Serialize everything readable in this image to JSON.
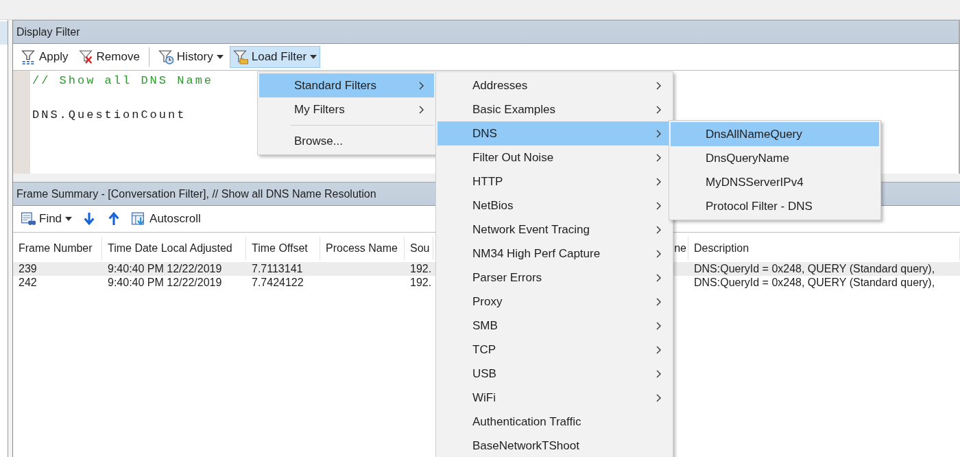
{
  "display_filter": {
    "title": "Display Filter",
    "toolbar": [
      {
        "kind": "button",
        "label": "Apply",
        "dropdown": false,
        "selected": false
      },
      {
        "kind": "button",
        "label": "Remove",
        "dropdown": false,
        "selected": false
      },
      {
        "kind": "separator"
      },
      {
        "kind": "button",
        "label": "History",
        "dropdown": true,
        "selected": false
      },
      {
        "kind": "button",
        "label": "Load Filter",
        "dropdown": true,
        "selected": true
      }
    ],
    "editor": {
      "lines": [
        {
          "kind": "comment",
          "text": "// Show all DNS Name"
        },
        {
          "kind": "blank"
        },
        {
          "kind": "code",
          "text": "DNS.QuestionCount"
        }
      ]
    }
  },
  "frame_summary": {
    "title": "Frame Summary - [Conversation Filter], // Show all DNS Name Resolution",
    "toolbar": [
      {
        "kind": "button",
        "label": "Find",
        "dropdown": true
      },
      {
        "kind": "icon"
      },
      {
        "kind": "icon"
      },
      {
        "kind": "button",
        "label": "Autoscroll",
        "dropdown": false
      }
    ],
    "table": {
      "columns": [
        "Frame Number",
        "Time Date Local Adjusted",
        "Time Offset",
        "Process Name",
        "Sou",
        "ne",
        "Description"
      ],
      "rows": [
        {
          "selected": true,
          "cells": [
            "239",
            "9:40:40 PM 12/22/2019",
            "7.7113141",
            null,
            "192.",
            null,
            "DNS:QueryId = 0x248, QUERY (Standard query),"
          ]
        },
        {
          "selected": false,
          "cells": [
            "242",
            "9:40:40 PM 12/22/2019",
            "7.7424122",
            null,
            "192.",
            null,
            "DNS:QueryId = 0x248, QUERY (Standard query),"
          ]
        }
      ]
    }
  },
  "menus": [
    {
      "items": [
        {
          "kind": "submenu",
          "label": "Standard Filters",
          "selected": true
        },
        {
          "kind": "submenu",
          "label": "My Filters",
          "selected": false
        },
        {
          "kind": "separator"
        },
        {
          "kind": "item",
          "label": "Browse...",
          "selected": false
        }
      ]
    },
    {
      "items": [
        {
          "kind": "submenu",
          "label": "Addresses",
          "selected": false
        },
        {
          "kind": "submenu",
          "label": "Basic Examples",
          "selected": false
        },
        {
          "kind": "submenu",
          "label": "DNS",
          "selected": true
        },
        {
          "kind": "submenu",
          "label": "Filter Out Noise",
          "selected": false
        },
        {
          "kind": "submenu",
          "label": "HTTP",
          "selected": false
        },
        {
          "kind": "submenu",
          "label": "NetBios",
          "selected": false
        },
        {
          "kind": "submenu",
          "label": "Network Event Tracing",
          "selected": false
        },
        {
          "kind": "submenu",
          "label": "NM34 High Perf Capture",
          "selected": false
        },
        {
          "kind": "submenu",
          "label": "Parser Errors",
          "selected": false
        },
        {
          "kind": "submenu",
          "label": "Proxy",
          "selected": false
        },
        {
          "kind": "submenu",
          "label": "SMB",
          "selected": false
        },
        {
          "kind": "submenu",
          "label": "TCP",
          "selected": false
        },
        {
          "kind": "submenu",
          "label": "USB",
          "selected": false
        },
        {
          "kind": "submenu",
          "label": "WiFi",
          "selected": false
        },
        {
          "kind": "item",
          "label": "Authentication Traffic",
          "selected": false
        },
        {
          "kind": "item",
          "label": "BaseNetworkTShoot",
          "selected": false
        }
      ]
    },
    {
      "items": [
        {
          "kind": "item",
          "label": "DnsAllNameQuery",
          "selected": true
        },
        {
          "kind": "item",
          "label": "DnsQueryName",
          "selected": false
        },
        {
          "kind": "item",
          "label": "MyDNSServerIPv4",
          "selected": false
        },
        {
          "kind": "item",
          "label": "Protocol Filter - DNS",
          "selected": false
        }
      ]
    }
  ]
}
